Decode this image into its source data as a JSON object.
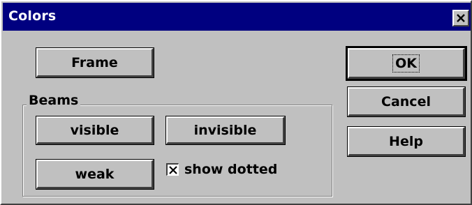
{
  "window": {
    "title": "Colors",
    "close_icon": "close-icon"
  },
  "buttons": {
    "frame": "Frame",
    "visible": "visible",
    "invisible": "invisible",
    "weak": "weak",
    "ok": "OK",
    "cancel": "Cancel",
    "help": "Help"
  },
  "beams_group": {
    "label": "Beams",
    "show_dotted_label": "show dotted",
    "show_dotted_checked": true
  },
  "colors": {
    "titlebar": "#000080",
    "face": "#c0c0c0"
  }
}
